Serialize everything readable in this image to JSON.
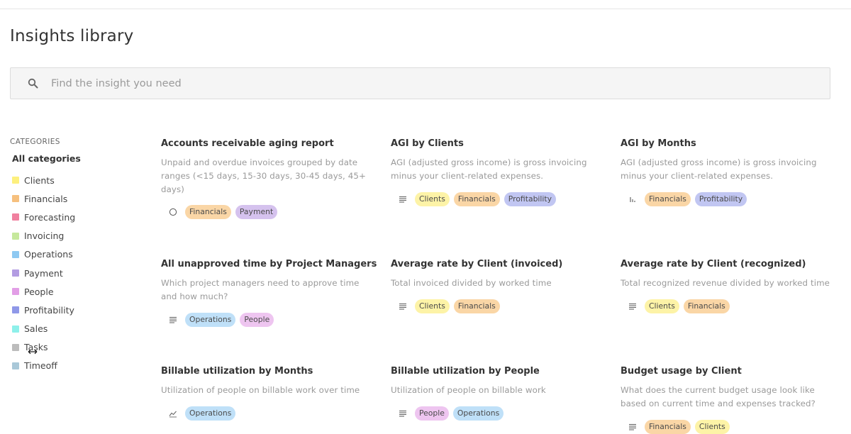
{
  "page": {
    "title": "Insights library"
  },
  "search": {
    "placeholder": "Find the insight you need"
  },
  "sidebar": {
    "heading": "CATEGORIES",
    "all_label": "All categories",
    "items": [
      {
        "label": "Clients",
        "color": "#fdf07e"
      },
      {
        "label": "Financials",
        "color": "#f6c07e"
      },
      {
        "label": "Forecasting",
        "color": "#f0809f"
      },
      {
        "label": "Invoicing",
        "color": "#c6e89c"
      },
      {
        "label": "Operations",
        "color": "#8ec9f2"
      },
      {
        "label": "Payment",
        "color": "#b39ce2"
      },
      {
        "label": "People",
        "color": "#e29ee6"
      },
      {
        "label": "Profitability",
        "color": "#8f98e8"
      },
      {
        "label": "Sales",
        "color": "#8ef0ea"
      },
      {
        "label": "Tasks",
        "color": "#bcbcbc"
      },
      {
        "label": "Timeoff",
        "color": "#a9c8d8"
      }
    ]
  },
  "cards": [
    {
      "title": "Accounts receivable aging report",
      "description": "Unpaid and overdue invoices grouped by date ranges (<15 days, 15-30 days, 30-45 days, 45+ days)",
      "icon": "circle-icon",
      "tags": [
        {
          "label": "Financials",
          "class": "financials"
        },
        {
          "label": "Payment",
          "class": "payment"
        }
      ]
    },
    {
      "title": "AGI by Clients",
      "description": "AGI (adjusted gross income) is gross invoicing minus your client-related expenses.",
      "icon": "table-icon",
      "tags": [
        {
          "label": "Clients",
          "class": "clients"
        },
        {
          "label": "Financials",
          "class": "financials"
        },
        {
          "label": "Profitability",
          "class": "profitability"
        }
      ]
    },
    {
      "title": "AGI by Months",
      "description": "AGI (adjusted gross income) is gross invoicing minus your client-related expenses.",
      "icon": "bar-chart-icon",
      "tags": [
        {
          "label": "Financials",
          "class": "financials"
        },
        {
          "label": "Profitability",
          "class": "profitability"
        }
      ]
    },
    {
      "title": "All unapproved time by Project Managers",
      "description": "Which project managers need to approve time and how much?",
      "icon": "table-icon",
      "tags": [
        {
          "label": "Operations",
          "class": "operations"
        },
        {
          "label": "People",
          "class": "people"
        }
      ]
    },
    {
      "title": "Average rate by Client (invoiced)",
      "description": "Total invoiced divided by worked time",
      "icon": "table-icon",
      "tags": [
        {
          "label": "Clients",
          "class": "clients"
        },
        {
          "label": "Financials",
          "class": "financials"
        }
      ]
    },
    {
      "title": "Average rate by Client (recognized)",
      "description": "Total recognized revenue divided by worked time",
      "icon": "table-icon",
      "tags": [
        {
          "label": "Clients",
          "class": "clients"
        },
        {
          "label": "Financials",
          "class": "financials"
        }
      ]
    },
    {
      "title": "Billable utilization by Months",
      "description": "Utilization of people on billable work over time",
      "icon": "line-chart-icon",
      "tags": [
        {
          "label": "Operations",
          "class": "operations"
        }
      ]
    },
    {
      "title": "Billable utilization by People",
      "description": "Utilization of people on billable work",
      "icon": "table-icon",
      "tags": [
        {
          "label": "People",
          "class": "people"
        },
        {
          "label": "Operations",
          "class": "operations"
        }
      ]
    },
    {
      "title": "Budget usage by Client",
      "description": "What does the current budget usage look like based on current time and expenses tracked?",
      "icon": "table-icon",
      "tags": [
        {
          "label": "Financials",
          "class": "financials"
        },
        {
          "label": "Clients",
          "class": "clients"
        }
      ]
    }
  ]
}
